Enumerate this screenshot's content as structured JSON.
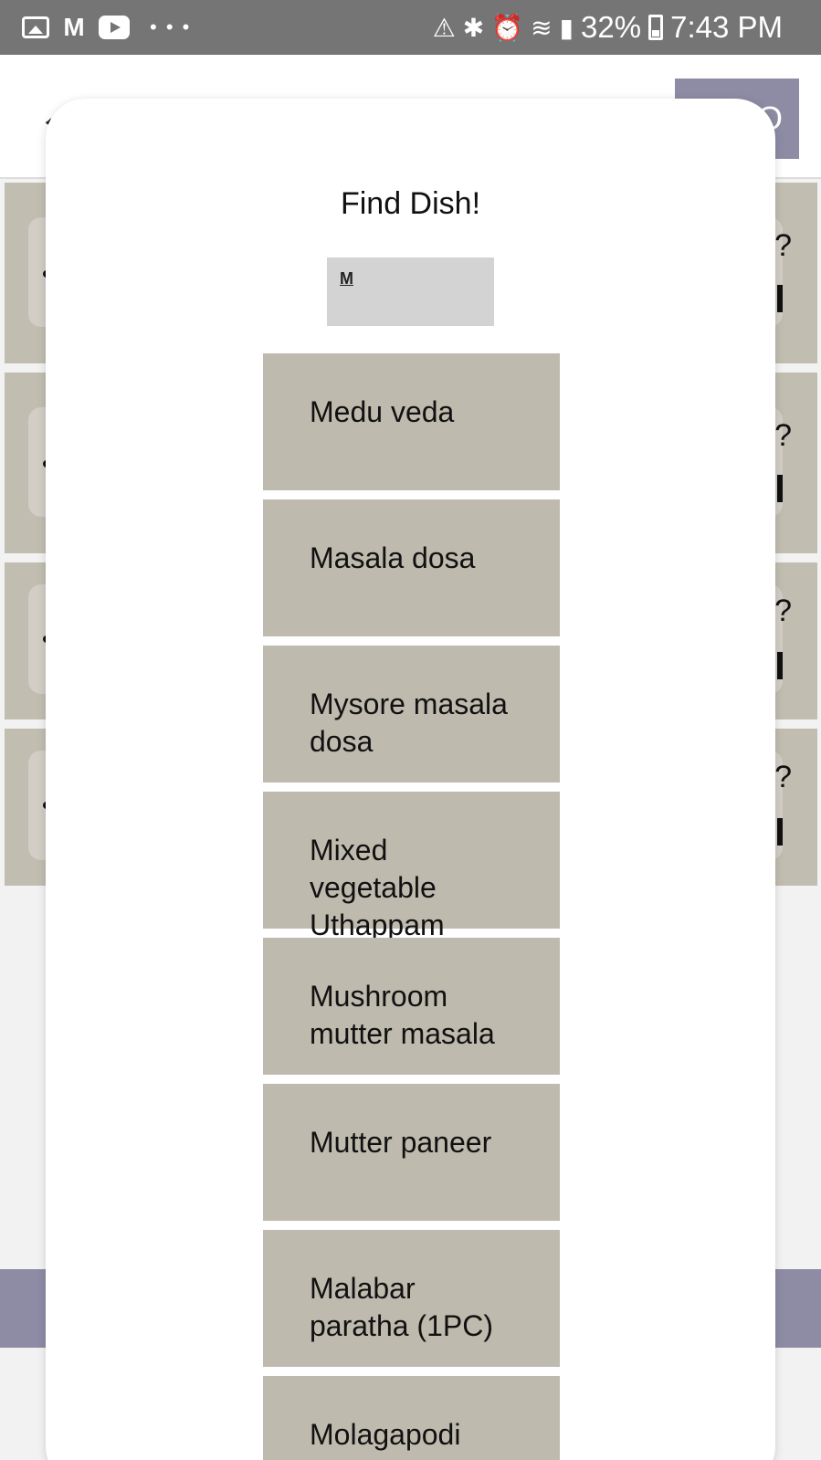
{
  "status_bar": {
    "dots": "• • •",
    "battery": "32%",
    "time": "7:43 PM",
    "icons": [
      "gallery-icon",
      "gmail-icon",
      "youtube-icon",
      "data-saver-icon",
      "bluetooth-icon",
      "alarm-icon",
      "wifi-icon",
      "signal-icon",
      "battery-icon"
    ]
  },
  "modal": {
    "title": "Find Dish!",
    "search_value": "M"
  },
  "dishes": [
    "Medu veda",
    "Masala dosa",
    "Mysore masala dosa",
    "Mixed vegetable Uthappam",
    "Mushroom mutter masala",
    "Mutter paneer",
    "Malabar paratha (1PC)",
    "Molagapodi"
  ],
  "colors": {
    "status_bar": "#757575",
    "accent_button": "#8e8ca5",
    "result_item": "#bfbaae",
    "input_bg": "#d3d3d3"
  }
}
